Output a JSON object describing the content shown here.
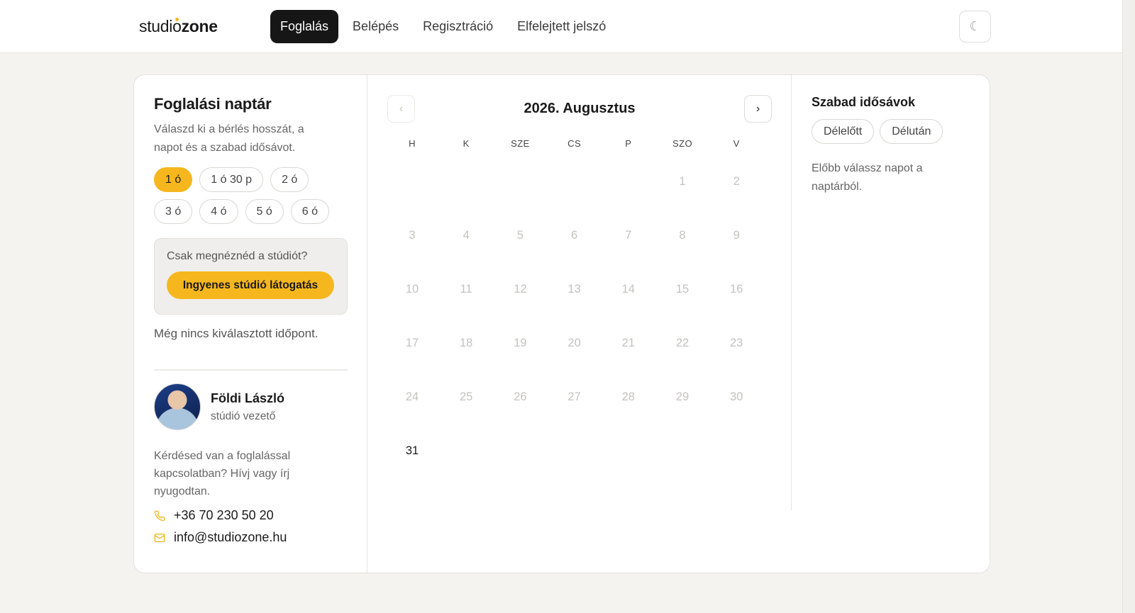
{
  "brand": {
    "text_a": "studi",
    "text_i": "o",
    "text_b": "zone",
    "accent": "#f6b71e"
  },
  "nav": {
    "items": [
      {
        "label": "Foglalás",
        "active": true
      },
      {
        "label": "Belépés"
      },
      {
        "label": "Regisztráció"
      },
      {
        "label": "Elfelejtett jelszó"
      }
    ],
    "theme_icon": "☾"
  },
  "left": {
    "title": "Foglalási naptár",
    "subtitle": "Válaszd ki a bérlés hosszát, a napot és a szabad idősávot.",
    "durations": [
      {
        "label": "1 ó",
        "selected": true
      },
      {
        "label": "1 ó 30 p"
      },
      {
        "label": "2 ó"
      },
      {
        "label": "3 ó"
      },
      {
        "label": "4 ó"
      },
      {
        "label": "5 ó"
      },
      {
        "label": "6 ó"
      }
    ],
    "visit_question": "Csak megnéznéd a stúdiót?",
    "visit_button": "Ingyenes stúdió látogatás",
    "no_selection": "Még nincs kiválasztott időpont.",
    "contact": {
      "name": "Földi László",
      "role": "stúdió vezető",
      "text": "Kérdésed van a foglalással kapcsolatban? Hívj vagy írj nyugodtan.",
      "phone": "+36 70 230 50 20",
      "email": "info@studiozone.hu"
    }
  },
  "calendar": {
    "title": "2026. Augusztus",
    "prev": "‹",
    "next": "›",
    "weekdays": [
      "H",
      "K",
      "SZE",
      "CS",
      "P",
      "SZO",
      "V"
    ],
    "days": [
      {
        "d": "1",
        "col": 5,
        "row": 0
      },
      {
        "d": "2",
        "col": 6,
        "row": 0
      },
      {
        "d": "3",
        "col": 0,
        "row": 1
      },
      {
        "d": "4",
        "col": 1,
        "row": 1
      },
      {
        "d": "5",
        "col": 2,
        "row": 1
      },
      {
        "d": "6",
        "col": 3,
        "row": 1
      },
      {
        "d": "7",
        "col": 4,
        "row": 1
      },
      {
        "d": "8",
        "col": 5,
        "row": 1
      },
      {
        "d": "9",
        "col": 6,
        "row": 1
      },
      {
        "d": "10",
        "col": 0,
        "row": 2
      },
      {
        "d": "11",
        "col": 1,
        "row": 2
      },
      {
        "d": "12",
        "col": 2,
        "row": 2
      },
      {
        "d": "13",
        "col": 3,
        "row": 2
      },
      {
        "d": "14",
        "col": 4,
        "row": 2
      },
      {
        "d": "15",
        "col": 5,
        "row": 2
      },
      {
        "d": "16",
        "col": 6,
        "row": 2
      },
      {
        "d": "17",
        "col": 0,
        "row": 3
      },
      {
        "d": "18",
        "col": 1,
        "row": 3
      },
      {
        "d": "19",
        "col": 2,
        "row": 3
      },
      {
        "d": "20",
        "col": 3,
        "row": 3
      },
      {
        "d": "21",
        "col": 4,
        "row": 3
      },
      {
        "d": "22",
        "col": 5,
        "row": 3
      },
      {
        "d": "23",
        "col": 6,
        "row": 3
      },
      {
        "d": "24",
        "col": 0,
        "row": 4
      },
      {
        "d": "25",
        "col": 1,
        "row": 4
      },
      {
        "d": "26",
        "col": 2,
        "row": 4
      },
      {
        "d": "27",
        "col": 3,
        "row": 4
      },
      {
        "d": "28",
        "col": 4,
        "row": 4
      },
      {
        "d": "29",
        "col": 5,
        "row": 4
      },
      {
        "d": "30",
        "col": 6,
        "row": 4
      },
      {
        "d": "31",
        "col": 0,
        "row": 5,
        "available": true
      }
    ]
  },
  "right": {
    "title": "Szabad idősávok",
    "periods": [
      "Délelőtt",
      "Délután"
    ],
    "note": "Előbb válassz napot a naptárból."
  }
}
